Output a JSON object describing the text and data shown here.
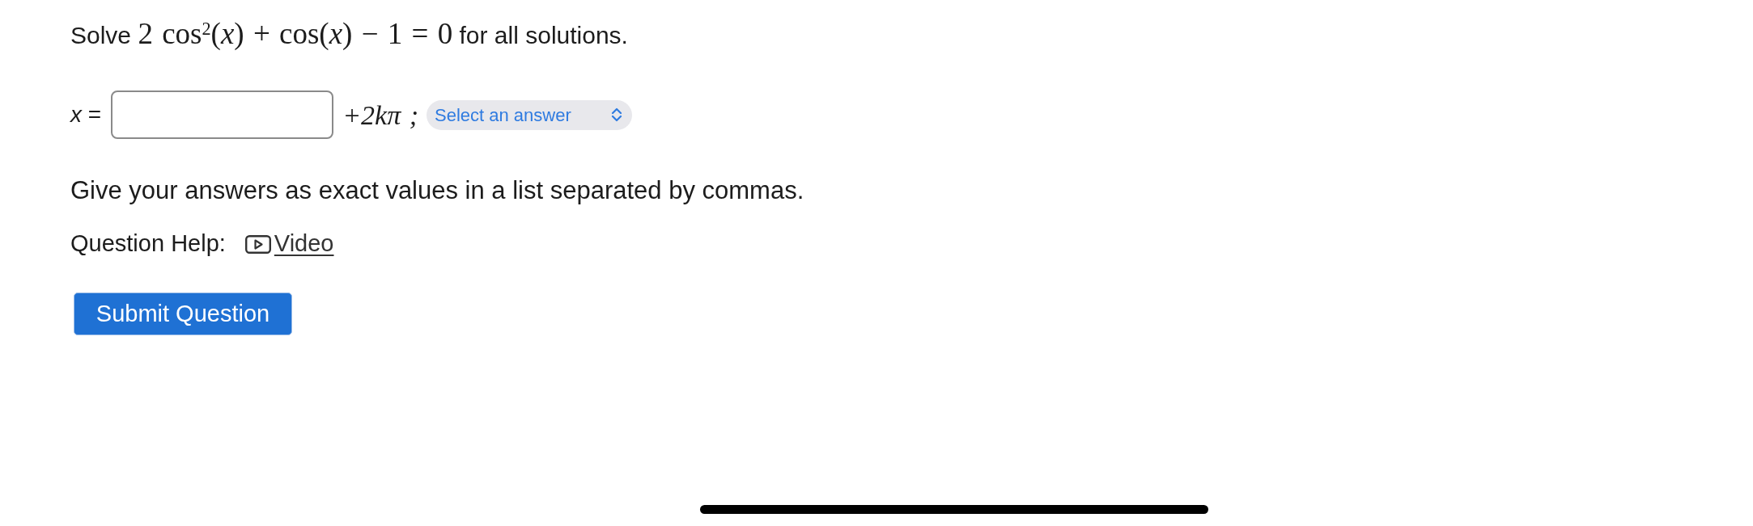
{
  "question": {
    "prefix": "Solve",
    "math": "2 cos$^{2}$(*x*) + cos(*x*) − 1 = 0",
    "suffix": "for all solutions."
  },
  "answer_row": [
    {
      "kind": "label",
      "text": "*x* ="
    },
    {
      "kind": "input"
    },
    {
      "kind": "math",
      "text": "+2kπ ;"
    },
    {
      "kind": "dropdown",
      "value": "Select an answer"
    }
  ],
  "instructions": "Give your answers as exact values in a list separated by commas.",
  "help": {
    "label": "Question Help:",
    "links": [
      {
        "kind": "video",
        "text": "Video"
      }
    ]
  },
  "submit": {
    "label": "Submit Question"
  }
}
